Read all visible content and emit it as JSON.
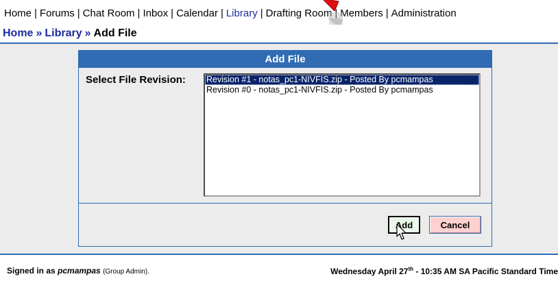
{
  "nav": {
    "items": [
      {
        "label": "Home"
      },
      {
        "label": "Forums"
      },
      {
        "label": "Chat Room"
      },
      {
        "label": "Inbox"
      },
      {
        "label": "Calendar"
      },
      {
        "label": "Library",
        "active": true
      },
      {
        "label": "Drafting Room"
      },
      {
        "label": "Members"
      },
      {
        "label": "Administration"
      }
    ],
    "separator": "|",
    "active_color": "#1c2ea0"
  },
  "breadcrumb": {
    "home": "Home",
    "section": "Library",
    "current": "Add File",
    "separator": "»"
  },
  "form": {
    "title": "Add File",
    "field_label": "Select File Revision:",
    "revisions": [
      {
        "label": "Revision #1 - notas_pc1-NIVFIS.zip - Posted By pcmampas",
        "selected": true
      },
      {
        "label": "Revision #0 - notas_pc1-NIVFIS.zip - Posted By pcmampas",
        "selected": false
      }
    ],
    "add_label": "Add",
    "cancel_label": "Cancel"
  },
  "footer": {
    "signed_prefix": "Signed in as",
    "user": "pcmampas",
    "role": "(Group Admin).",
    "date_day": "Wednesday April 27",
    "date_suffix": "th",
    "time": "- 10:35 AM SA Pacific Standard Time"
  },
  "colors": {
    "header_blue": "#2f6cb3",
    "link_blue": "#1b2c9d",
    "content_bg": "#ececec",
    "add_bg": "#eaf6e9",
    "cancel_bg": "#ffd0d0"
  },
  "icons": {
    "pointer": "arrow-cursor-icon",
    "hand": "pointer-cursor-icon"
  }
}
